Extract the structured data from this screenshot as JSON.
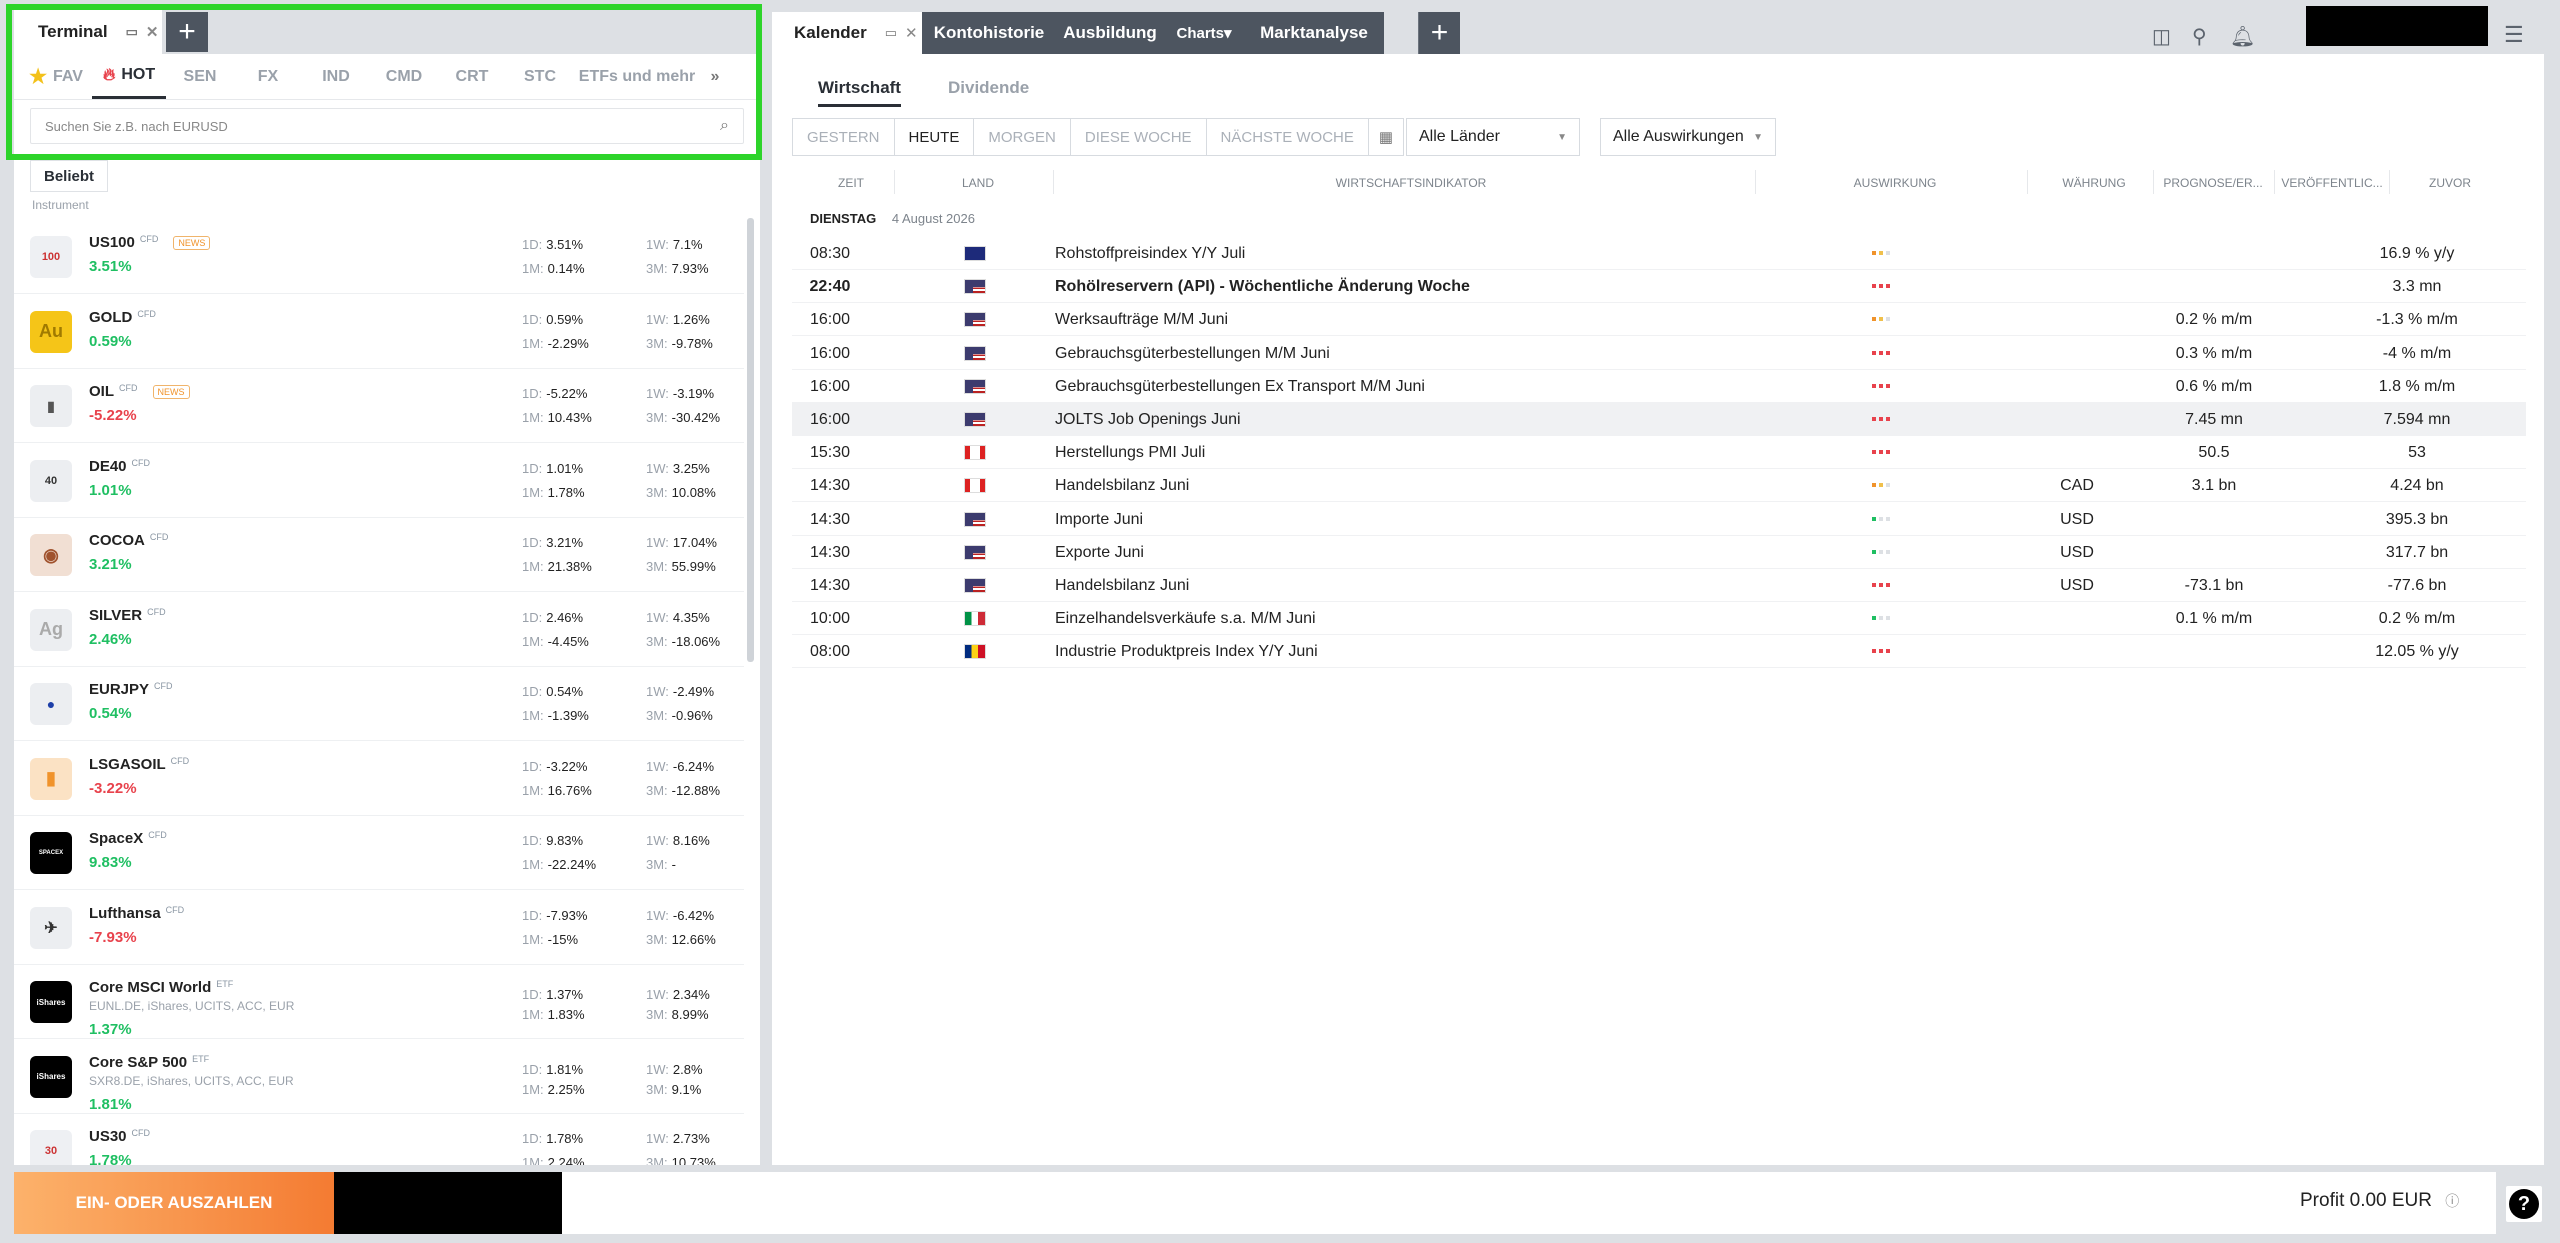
{
  "left_panel": {
    "tab_label": "Terminal",
    "categories": [
      {
        "label": "FAV",
        "icon": "star-icon"
      },
      {
        "label": "HOT",
        "icon": "flame-icon"
      },
      {
        "label": "SEN"
      },
      {
        "label": "FX"
      },
      {
        "label": "IND"
      },
      {
        "label": "CMD"
      },
      {
        "label": "CRT"
      },
      {
        "label": "STC"
      },
      {
        "label": "ETFs und mehr"
      }
    ],
    "search_placeholder": "Suchen Sie z.B. nach EURUSD",
    "sort_label": "Beliebt",
    "instrument_label": "Instrument",
    "instruments": [
      {
        "name": "US100",
        "tag": "CFD",
        "news": "NEWS",
        "change": "3.51%",
        "d1": "3.51%",
        "m1": "0.14%",
        "w1": "7.1%",
        "m3": "7.93%",
        "dir": "up",
        "icon_text": "100"
      },
      {
        "name": "GOLD",
        "tag": "CFD",
        "news": "",
        "change": "0.59%",
        "d1": "0.59%",
        "m1": "-2.29%",
        "w1": "1.26%",
        "m3": "-9.78%",
        "dir": "up",
        "icon_text": "Au"
      },
      {
        "name": "OIL",
        "tag": "CFD",
        "news": "NEWS",
        "change": "-5.22%",
        "d1": "-5.22%",
        "m1": "10.43%",
        "w1": "-3.19%",
        "m3": "-30.42%",
        "dir": "dn",
        "icon_text": "▮"
      },
      {
        "name": "DE40",
        "tag": "CFD",
        "news": "",
        "change": "1.01%",
        "d1": "1.01%",
        "m1": "1.78%",
        "w1": "3.25%",
        "m3": "10.08%",
        "dir": "up",
        "icon_text": "40"
      },
      {
        "name": "COCOA",
        "tag": "CFD",
        "news": "",
        "change": "3.21%",
        "d1": "3.21%",
        "m1": "21.38%",
        "w1": "17.04%",
        "m3": "55.99%",
        "dir": "up",
        "icon_text": "◉"
      },
      {
        "name": "SILVER",
        "tag": "CFD",
        "news": "",
        "change": "2.46%",
        "d1": "2.46%",
        "m1": "-4.45%",
        "w1": "4.35%",
        "m3": "-18.06%",
        "dir": "up",
        "icon_text": "Ag"
      },
      {
        "name": "EURJPY",
        "tag": "CFD",
        "news": "",
        "change": "0.54%",
        "d1": "0.54%",
        "m1": "-1.39%",
        "w1": "-2.49%",
        "m3": "-0.96%",
        "dir": "up",
        "icon_text": "●"
      },
      {
        "name": "LSGASOIL",
        "tag": "CFD",
        "news": "",
        "change": "-3.22%",
        "d1": "-3.22%",
        "m1": "16.76%",
        "w1": "-6.24%",
        "m3": "-12.88%",
        "dir": "dn",
        "icon_text": "▮"
      },
      {
        "name": "SpaceX",
        "tag": "CFD",
        "news": "",
        "change": "9.83%",
        "d1": "9.83%",
        "m1": "-22.24%",
        "w1": "8.16%",
        "m3": "-",
        "dir": "up",
        "icon_text": "SPACEX"
      },
      {
        "name": "Lufthansa",
        "tag": "CFD",
        "news": "",
        "change": "-7.93%",
        "d1": "-7.93%",
        "m1": "-15%",
        "w1": "-6.42%",
        "m3": "12.66%",
        "dir": "dn",
        "icon_text": "✈"
      },
      {
        "name": "Core MSCI World",
        "tag": "ETF",
        "news": "",
        "sub": "EUNL.DE, iShares, UCITS, ACC, EUR",
        "change": "1.37%",
        "d1": "1.37%",
        "m1": "1.83%",
        "w1": "2.34%",
        "m3": "8.99%",
        "dir": "up",
        "icon_text": "iShares"
      },
      {
        "name": "Core S&P 500",
        "tag": "ETF",
        "news": "",
        "sub": "SXR8.DE, iShares, UCITS, ACC, EUR",
        "change": "1.81%",
        "d1": "1.81%",
        "m1": "2.25%",
        "w1": "2.8%",
        "m3": "9.1%",
        "dir": "up",
        "icon_text": "iShares"
      },
      {
        "name": "US30",
        "tag": "CFD",
        "news": "",
        "change": "1.78%",
        "d1": "1.78%",
        "m1": "2.24%",
        "w1": "2.73%",
        "m3": "10.73%",
        "dir": "up",
        "icon_text": "30"
      }
    ],
    "stat_labels": {
      "d1": "1D:",
      "m1": "1M:",
      "w1": "1W:",
      "m3": "3M:"
    }
  },
  "right_panel": {
    "tabs": [
      "Kalender",
      "Kontohistorie",
      "Ausbildung",
      "Charts▾",
      "Marktanalyse"
    ],
    "subtabs": [
      "Wirtschaft",
      "Dividende"
    ],
    "days": [
      "GESTERN",
      "HEUTE",
      "MORGEN",
      "DIESE WOCHE",
      "NÄCHSTE WOCHE"
    ],
    "country_filter": "Alle Länder",
    "impact_filter": "Alle Auswirkungen",
    "columns": [
      "ZEIT",
      "LAND",
      "WIRTSCHAFTSINDIKATOR",
      "AUSWIRKUNG",
      "WÄHRUNG",
      "PROGNOSE/ER...",
      "VERÖFFENTLIC...",
      "ZUVOR"
    ],
    "day_label": "DIENSTAG",
    "day_date": "4 August 2026",
    "events": [
      {
        "time": "08:30",
        "flag": "AU",
        "name": "Rohstoffpreisindex Y/Y Juli",
        "impact": "medium",
        "currency": "",
        "forecast": "",
        "previous": "16.9 % y/y",
        "bold": false
      },
      {
        "time": "22:40",
        "flag": "US",
        "name": "Rohölreservern (API) - Wöchentliche Änderung Woche",
        "impact": "high",
        "currency": "",
        "forecast": "",
        "previous": "3.3 mn",
        "bold": true
      },
      {
        "time": "16:00",
        "flag": "US",
        "name": "Werksaufträge M/M Juni",
        "impact": "medium",
        "currency": "",
        "forecast": "0.2 % m/m",
        "previous": "-1.3 % m/m",
        "bold": false
      },
      {
        "time": "16:00",
        "flag": "US",
        "name": "Gebrauchsgüterbestellungen M/M Juni",
        "impact": "high",
        "currency": "",
        "forecast": "0.3 % m/m",
        "previous": "-4 % m/m",
        "bold": false
      },
      {
        "time": "16:00",
        "flag": "US",
        "name": "Gebrauchsgüterbestellungen Ex Transport M/M Juni",
        "impact": "high",
        "currency": "",
        "forecast": "0.6 % m/m",
        "previous": "1.8 % m/m",
        "bold": false
      },
      {
        "time": "16:00",
        "flag": "US",
        "name": "JOLTS Job Openings Juni",
        "impact": "high",
        "currency": "",
        "forecast": "7.45 mn",
        "previous": "7.594 mn",
        "bold": false
      },
      {
        "time": "15:30",
        "flag": "CA",
        "name": "Herstellungs PMI Juli",
        "impact": "high",
        "currency": "",
        "forecast": "50.5",
        "previous": "53",
        "bold": false
      },
      {
        "time": "14:30",
        "flag": "CA",
        "name": "Handelsbilanz Juni",
        "impact": "medium",
        "currency": "CAD",
        "forecast": "3.1 bn",
        "previous": "4.24 bn",
        "bold": false
      },
      {
        "time": "14:30",
        "flag": "US",
        "name": "Importe Juni",
        "impact": "low",
        "currency": "USD",
        "forecast": "",
        "previous": "395.3 bn",
        "bold": false
      },
      {
        "time": "14:30",
        "flag": "US",
        "name": "Exporte Juni",
        "impact": "low",
        "currency": "USD",
        "forecast": "",
        "previous": "317.7 bn",
        "bold": false
      },
      {
        "time": "14:30",
        "flag": "US",
        "name": "Handelsbilanz Juni",
        "impact": "high",
        "currency": "USD",
        "forecast": "-73.1 bn",
        "previous": "-77.6 bn",
        "bold": false
      },
      {
        "time": "10:00",
        "flag": "IT",
        "name": "Einzelhandelsverkäufe s.a. M/M Juni",
        "impact": "low",
        "currency": "",
        "forecast": "0.1 % m/m",
        "previous": "0.2 % m/m",
        "bold": false
      },
      {
        "time": "08:00",
        "flag": "RO",
        "name": "Industrie Produktpreis Index Y/Y Juni",
        "impact": "high",
        "currency": "",
        "forecast": "",
        "previous": "12.05 % y/y",
        "bold": false
      }
    ]
  },
  "bottom": {
    "pay_button": "EIN- ODER AUSZAHLEN",
    "profit": "Profit 0.00 EUR",
    "help": "?"
  },
  "colors": {
    "up": "#1fbf62",
    "down": "#e8424c",
    "accent": "#f47b32",
    "highlight": "#2dd42a"
  }
}
